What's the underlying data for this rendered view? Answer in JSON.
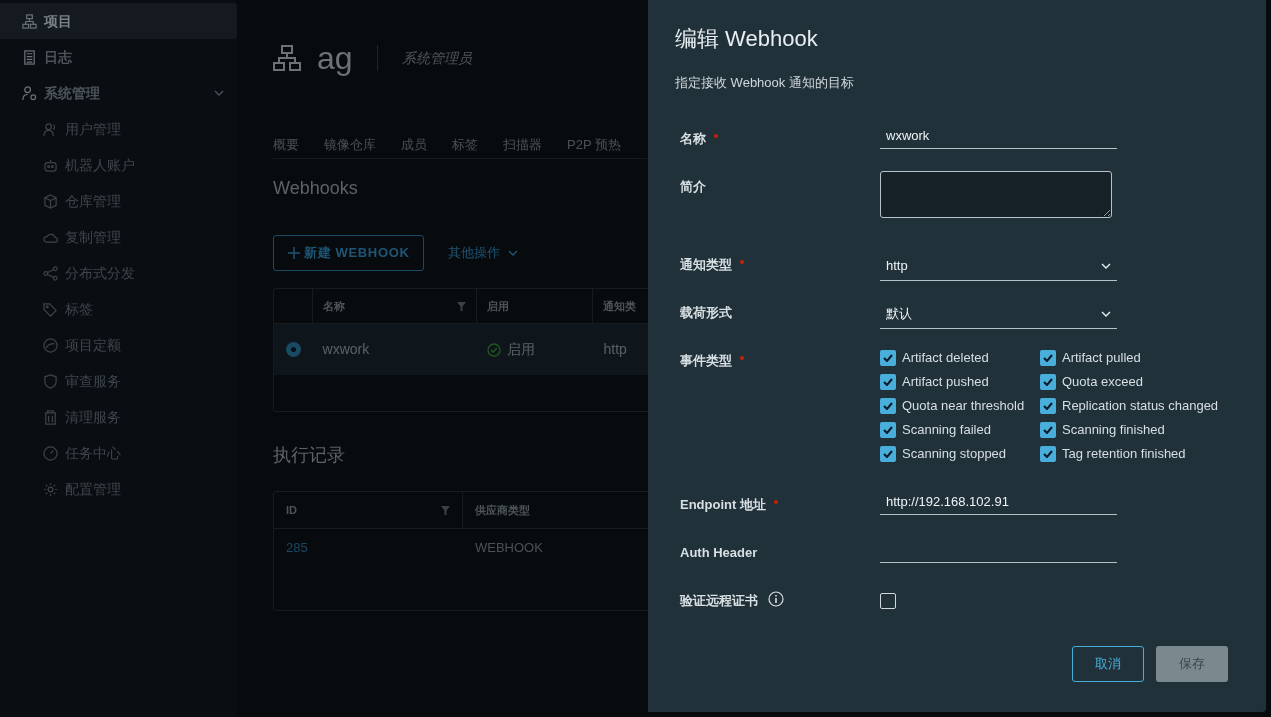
{
  "sidebar": {
    "items": [
      {
        "label": "项目",
        "selected": true
      },
      {
        "label": "日志",
        "selected": false
      },
      {
        "label": "系统管理",
        "selected": false,
        "expanded": true,
        "children": [
          {
            "label": "用户管理",
            "selected": false
          },
          {
            "label": "机器人账户",
            "selected": false
          },
          {
            "label": "仓库管理",
            "selected": false
          },
          {
            "label": "复制管理",
            "selected": false
          },
          {
            "label": "分布式分发",
            "selected": false
          },
          {
            "label": "标签",
            "selected": false
          },
          {
            "label": "项目定额",
            "selected": false
          },
          {
            "label": "审查服务",
            "selected": false
          },
          {
            "label": "清理服务",
            "selected": false
          },
          {
            "label": "任务中心",
            "selected": false
          },
          {
            "label": "配置管理",
            "selected": false
          }
        ]
      }
    ]
  },
  "project": {
    "name": "ag",
    "role": "系统管理员"
  },
  "tabs": [
    {
      "label": "概要",
      "selected": false
    },
    {
      "label": "镜像仓库",
      "selected": false
    },
    {
      "label": "成员",
      "selected": false
    },
    {
      "label": "标签",
      "selected": false
    },
    {
      "label": "扫描器",
      "selected": false
    },
    {
      "label": "P2P 预热",
      "selected": false
    }
  ],
  "webhooks": {
    "title": "Webhooks",
    "new_button": "新建 WEBHOOK",
    "more_actions": "其他操作",
    "columns": [
      "名称",
      "启用",
      "通知类"
    ],
    "rows": [
      {
        "selected": true,
        "name": "wxwork",
        "enabled": true,
        "status": "启用",
        "type": "http"
      }
    ]
  },
  "executions": {
    "title": "执行记录",
    "columns": [
      "ID",
      "供应商类型"
    ],
    "rows": [
      {
        "id": "285",
        "vendor": "WEBHOOK"
      }
    ]
  },
  "dialog": {
    "title": "编辑 Webhook",
    "subtitle": "指定接收 Webhook 通知的目标",
    "fields": [
      {
        "kind": "text",
        "label": "名称",
        "required": true,
        "value": "wxwork"
      },
      {
        "kind": "textarea",
        "label": "简介",
        "required": false
      },
      {
        "kind": "select",
        "label": "通知类型",
        "required": true,
        "value": "http"
      },
      {
        "kind": "select",
        "label": "载荷形式",
        "required": false,
        "value": "默认"
      },
      {
        "kind": "checks",
        "label": "事件类型",
        "required": true,
        "options": [
          {
            "label": "Artifact deleted",
            "checked": true
          },
          {
            "label": "Artifact pulled",
            "checked": true
          },
          {
            "label": "Artifact pushed",
            "checked": true
          },
          {
            "label": "Quota exceed",
            "checked": true
          },
          {
            "label": "Quota near threshold",
            "checked": true
          },
          {
            "label": "Replication status changed",
            "checked": true
          },
          {
            "label": "Scanning failed",
            "checked": true
          },
          {
            "label": "Scanning finished",
            "checked": true
          },
          {
            "label": "Scanning stopped",
            "checked": true
          },
          {
            "label": "Tag retention finished",
            "checked": true
          }
        ]
      },
      {
        "kind": "text",
        "label": "Endpoint 地址",
        "required": true,
        "value": "http://192.168.102.91"
      },
      {
        "kind": "text",
        "label": "Auth Header",
        "required": false
      },
      {
        "kind": "checkbox",
        "label": "验证远程证书",
        "required": false,
        "info": true,
        "checked": false
      }
    ],
    "buttons": [
      {
        "label": "取消",
        "kind": "outline",
        "disabled": false
      },
      {
        "label": "保存",
        "kind": "primary",
        "disabled": true
      }
    ]
  }
}
